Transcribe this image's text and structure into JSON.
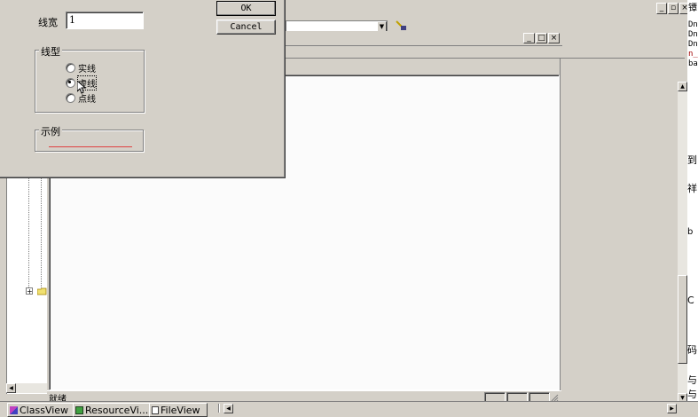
{
  "dialog": {
    "line_width_label": "线宽",
    "line_width_value": "1",
    "ok_label": "OK",
    "cancel_label": "Cancel",
    "line_type_group": "线型",
    "options": [
      {
        "label": "实线",
        "selected": false
      },
      {
        "label": "虚线",
        "selected": true
      },
      {
        "label": "点线",
        "selected": false
      }
    ],
    "sample_group": "示例",
    "sample_line_color": "#e04040"
  },
  "workspace": {
    "tree_expand_glyph": "+"
  },
  "status_bar": {
    "text": "就绪"
  },
  "bottom_tabs": [
    {
      "label": "ClassView",
      "icon": "class-icon"
    },
    {
      "label": "ResourceVi...",
      "icon": "resource-icon"
    },
    {
      "label": "FileView",
      "icon": "file-icon"
    }
  ],
  "code_editor": {
    "lines": [
      "Dn",
      "Dn",
      "Dn",
      "n_",
      "ba"
    ],
    "side_glyphs": [
      "到",
      "祥",
      "b",
      "C",
      "码",
      "与",
      "与"
    ]
  },
  "title_fragment": "镡"
}
